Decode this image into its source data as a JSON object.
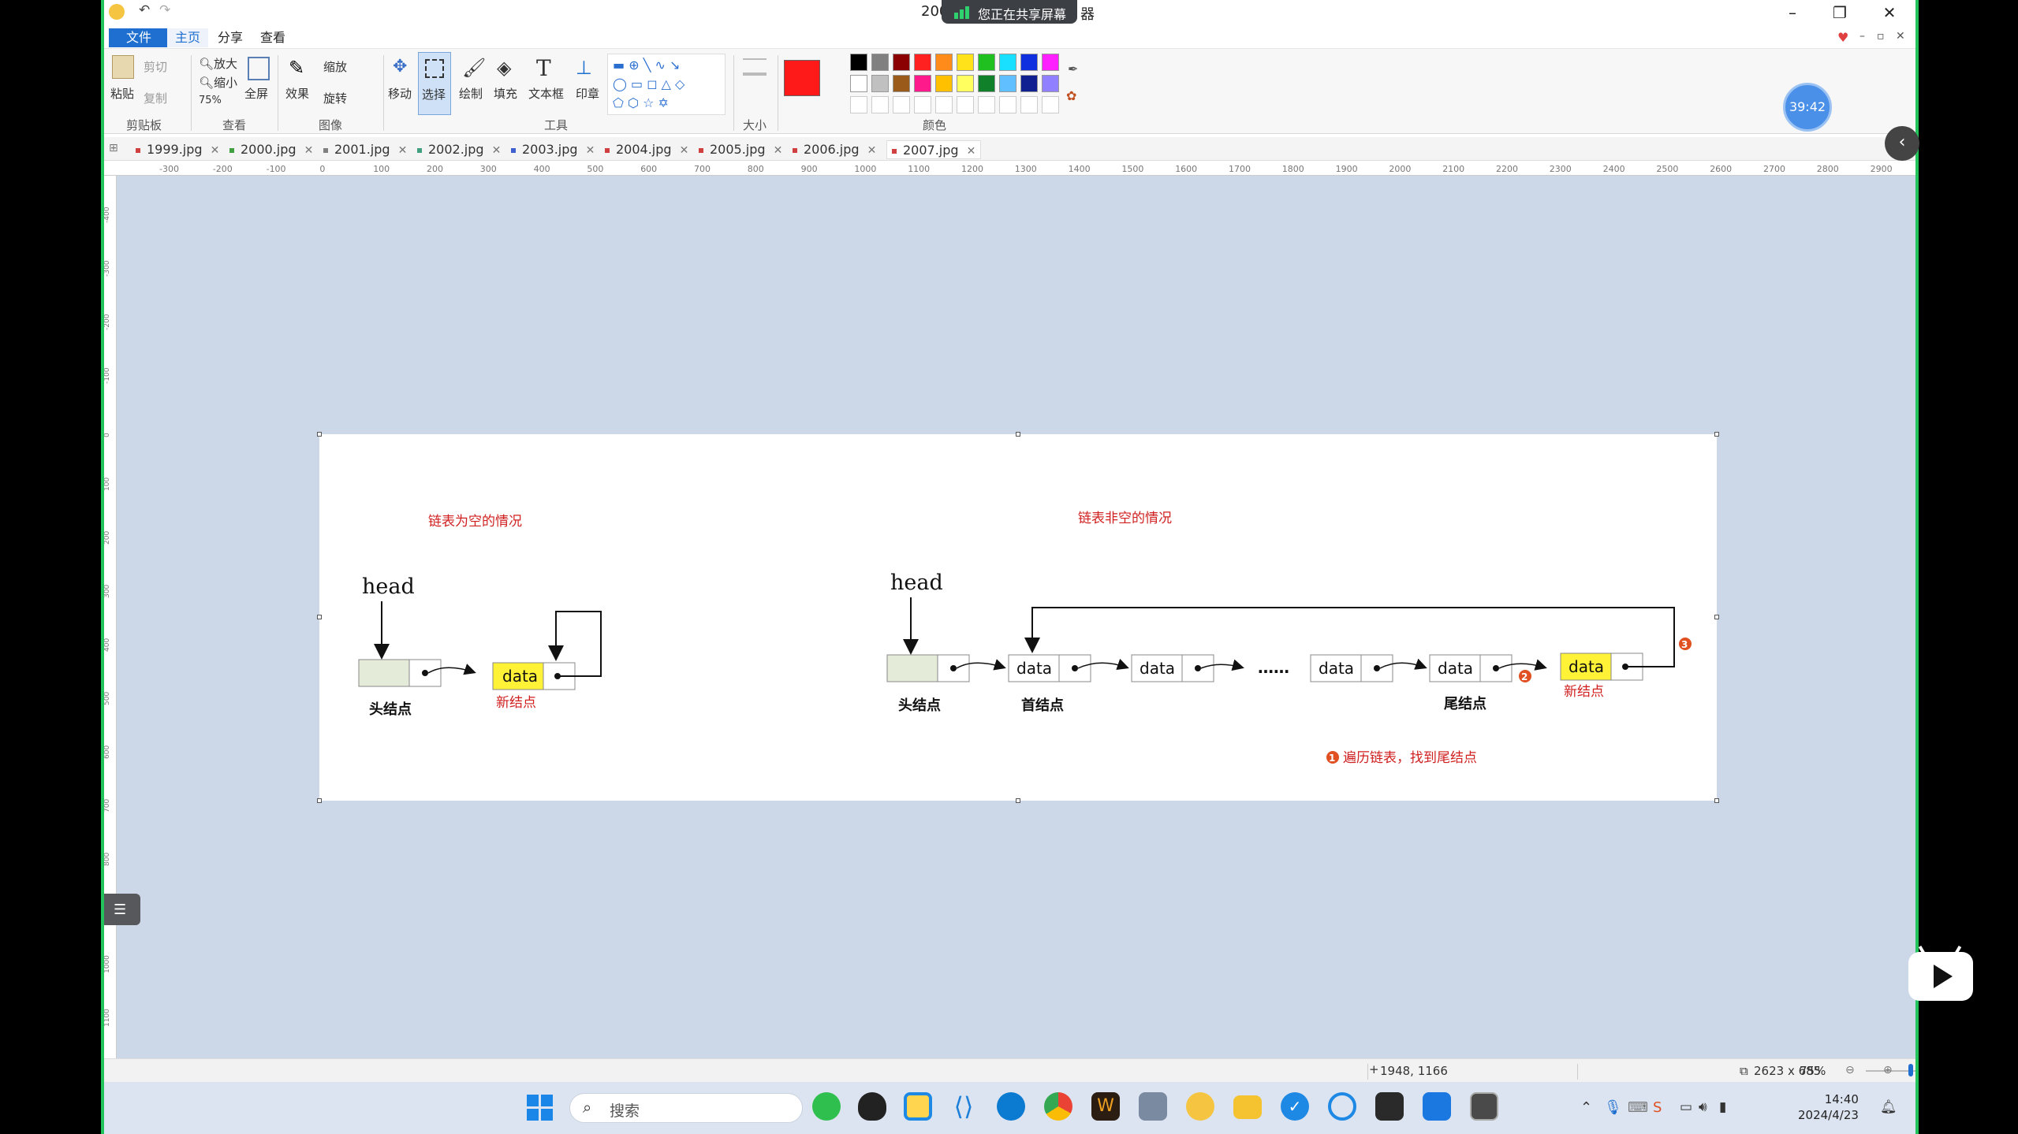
{
  "window": {
    "title_left": "200",
    "title_right": "器",
    "share_banner": "您正在共享屏幕"
  },
  "menu": {
    "file": "文件",
    "home": "主页",
    "share": "分享",
    "view": "查看"
  },
  "ribbon": {
    "paste": "粘贴",
    "cut": "剪切",
    "copy": "复制",
    "clipboard_group": "剪贴板",
    "zoom_in": "放大",
    "zoom_out": "缩小",
    "zoom_level": "75%",
    "view_group": "查看",
    "fullscreen": "全屏",
    "effects": "效果",
    "resize": "缩放",
    "rotate": "旋转",
    "image_group": "图像",
    "move": "移动",
    "select": "选择",
    "draw": "绘制",
    "fill": "填充",
    "textbox": "文本框",
    "stamp": "印章",
    "tools_group": "工具",
    "size_group": "大小",
    "colors_group": "颜色",
    "palette_row1": [
      "#000000",
      "#808080",
      "#8b0000",
      "#ff2020",
      "#ff8c1a",
      "#ffe21a",
      "#20c020",
      "#1ae0ff",
      "#1030e0",
      "#ff20ff"
    ],
    "palette_row2": [
      "#ffffff",
      "#c0c0c0",
      "#9a5a1a",
      "#ff1a8c",
      "#ffc000",
      "#ffff60",
      "#10802a",
      "#60c0ff",
      "#102090",
      "#9080ff"
    ],
    "primary_color": "#ff1a1a"
  },
  "tabs": [
    {
      "label": "1999.jpg",
      "dot": "#d04040"
    },
    {
      "label": "2000.jpg",
      "dot": "#40a040"
    },
    {
      "label": "2001.jpg",
      "dot": "#808080"
    },
    {
      "label": "2002.jpg",
      "dot": "#40a080"
    },
    {
      "label": "2003.jpg",
      "dot": "#4060d0"
    },
    {
      "label": "2004.jpg",
      "dot": "#d04040"
    },
    {
      "label": "2005.jpg",
      "dot": "#d04040"
    },
    {
      "label": "2006.jpg",
      "dot": "#d04040"
    },
    {
      "label": "2007.jpg",
      "dot": "#d04040"
    }
  ],
  "ruler": {
    "h_labels": [
      "-300",
      "-200",
      "-100",
      "0",
      "100",
      "200",
      "300",
      "400",
      "500",
      "600",
      "700",
      "800",
      "900",
      "1000",
      "1100",
      "1200",
      "1300",
      "1400",
      "1500",
      "1600",
      "1700",
      "1800",
      "1900",
      "2000",
      "2100",
      "2200",
      "2300",
      "2400",
      "2500",
      "2600",
      "2700",
      "2800",
      "2900"
    ],
    "v_labels": [
      "-400",
      "-300",
      "-200",
      "-100",
      "0",
      "100",
      "200",
      "300",
      "400",
      "500",
      "600",
      "700",
      "800",
      "900",
      "1000",
      "1100"
    ]
  },
  "diagram": {
    "title_empty": "链表为空的情况",
    "title_nonempty": "链表非空的情况",
    "head": "head",
    "data": "data",
    "head_node": "头结点",
    "new_node": "新结点",
    "first_node": "首结点",
    "tail_node": "尾结点",
    "ellipsis": "……",
    "step1_num": "1",
    "step2_num": "2",
    "step3_num": "3",
    "step1_text": "遍历链表，找到尾结点"
  },
  "status": {
    "cursor_pos": "1948, 1166",
    "image_size": "2623 x 685",
    "zoom": "75%"
  },
  "timer": "39:42",
  "taskbar": {
    "search_placeholder": "搜索",
    "time": "14:40",
    "date": "2024/4/23"
  }
}
